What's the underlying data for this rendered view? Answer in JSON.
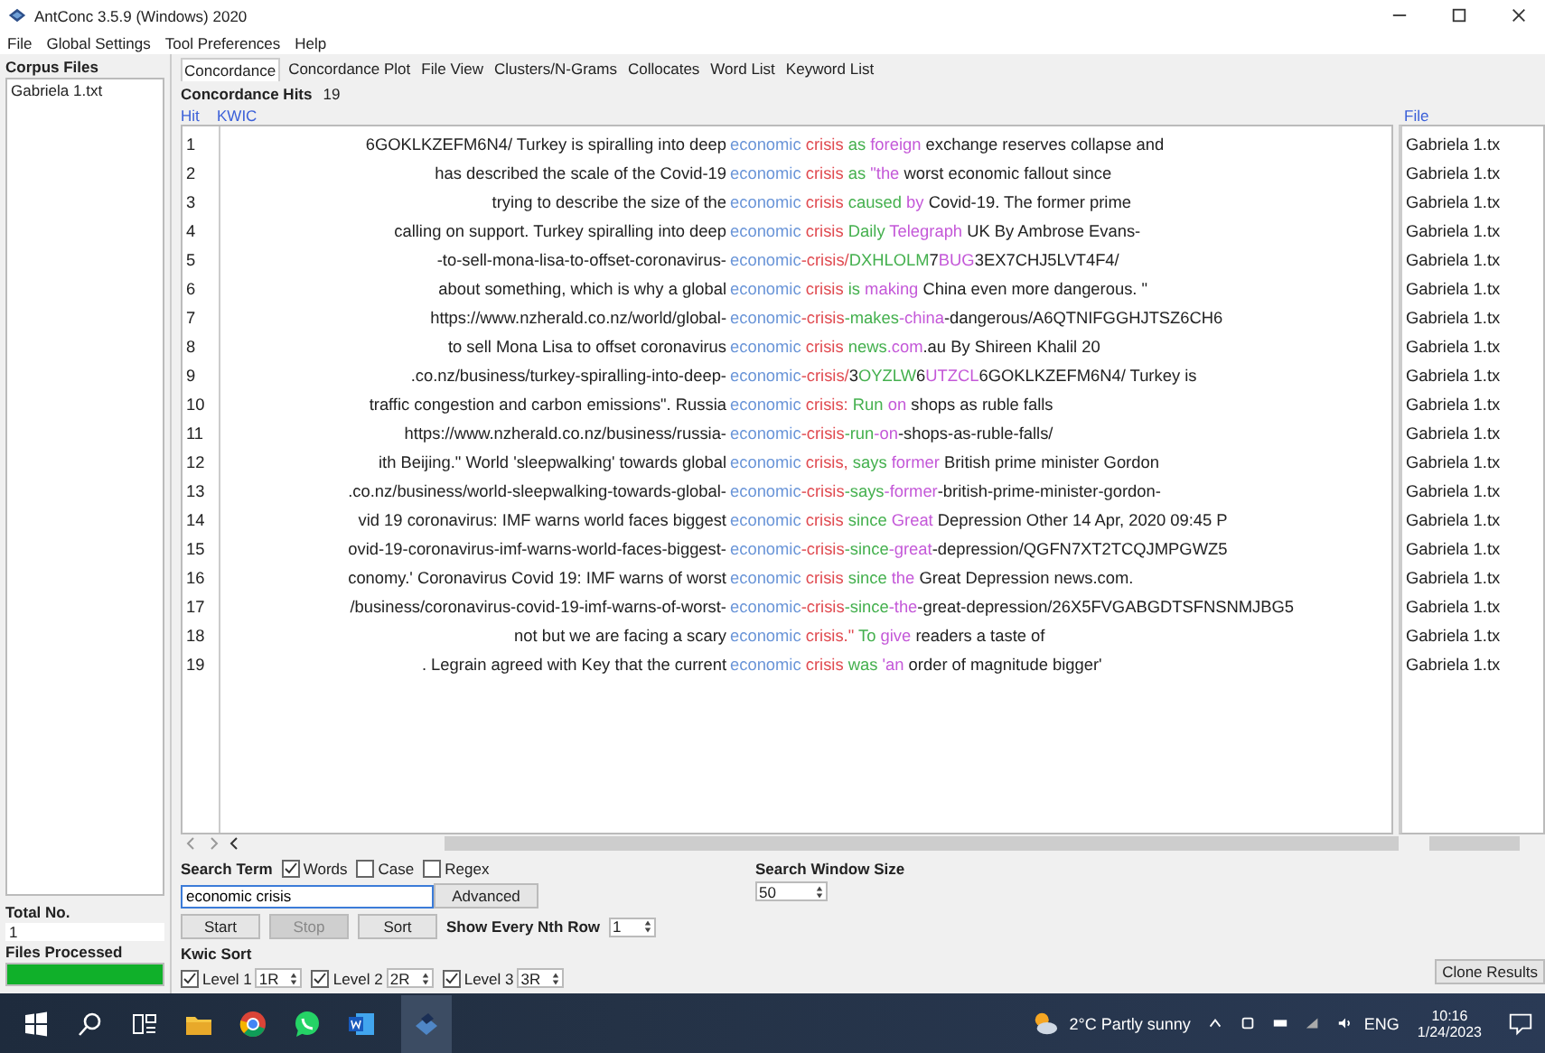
{
  "window": {
    "title": "AntConc 3.5.9 (Windows) 2020"
  },
  "menu": [
    "File",
    "Global Settings",
    "Tool Preferences",
    "Help"
  ],
  "sidebar": {
    "title": "Corpus Files",
    "files": [
      "Gabriela 1.txt"
    ],
    "total_label": "Total No.",
    "total": "1",
    "processed_label": "Files Processed",
    "progress": {
      "level": 1
    }
  },
  "tabs": [
    {
      "label": "Concordance",
      "selected": true
    },
    {
      "label": "Concordance Plot",
      "selected": false
    },
    {
      "label": "File View",
      "selected": false
    },
    {
      "label": "Clusters/N-Grams",
      "selected": false
    },
    {
      "label": "Collocates",
      "selected": false
    },
    {
      "label": "Word List",
      "selected": false
    },
    {
      "label": "Keyword List",
      "selected": false
    }
  ],
  "hits": {
    "label": "Concordance Hits",
    "count": "19"
  },
  "columns": {
    "hit": "Hit",
    "kwic": "KWIC",
    "file": "File"
  },
  "rows": [
    {
      "hit": "1",
      "left": "6GOKLKZEFM6N4/ Turkey is spiralling into deep",
      "segments": [
        {
          "text": "economic",
          "kind": "k"
        },
        {
          "text": " crisis",
          "kind": "r"
        },
        {
          "text": " as",
          "kind": "g"
        },
        {
          "text": " foreign",
          "kind": "p"
        },
        {
          "text": " exchange reserves collapse and",
          "kind": "t"
        }
      ],
      "file": "Gabriela 1.tx"
    },
    {
      "hit": "2",
      "left": "has described the scale of the Covid-19",
      "segments": [
        {
          "text": "economic",
          "kind": "k"
        },
        {
          "text": " crisis",
          "kind": "r"
        },
        {
          "text": " as",
          "kind": "g"
        },
        {
          "text": " \"the",
          "kind": "p"
        },
        {
          "text": " worst economic fallout since",
          "kind": "t"
        }
      ],
      "file": "Gabriela 1.tx"
    },
    {
      "hit": "3",
      "left": "trying to describe the size of the",
      "segments": [
        {
          "text": "economic",
          "kind": "k"
        },
        {
          "text": " crisis",
          "kind": "r"
        },
        {
          "text": " caused",
          "kind": "g"
        },
        {
          "text": " by",
          "kind": "p"
        },
        {
          "text": " Covid-19. The former prime",
          "kind": "t"
        }
      ],
      "file": "Gabriela 1.tx"
    },
    {
      "hit": "4",
      "left": "calling on support. Turkey spiralling into deep",
      "segments": [
        {
          "text": "economic",
          "kind": "k"
        },
        {
          "text": " crisis",
          "kind": "r"
        },
        {
          "text": " Daily",
          "kind": "g"
        },
        {
          "text": " Telegraph",
          "kind": "p"
        },
        {
          "text": " UK By Ambrose Evans-",
          "kind": "t"
        }
      ],
      "file": "Gabriela 1.tx"
    },
    {
      "hit": "5",
      "left": "-to-sell-mona-lisa-to-offset-coronavirus-",
      "segments": [
        {
          "text": "economic",
          "kind": "k"
        },
        {
          "text": "-crisis/",
          "kind": "r"
        },
        {
          "text": "DXHLOLM",
          "kind": "g"
        },
        {
          "text": "7",
          "kind": "t"
        },
        {
          "text": "BUG",
          "kind": "p"
        },
        {
          "text": "3EX7CHJ5LVT4F4/",
          "kind": "t"
        }
      ],
      "file": "Gabriela 1.tx"
    },
    {
      "hit": "6",
      "left": "about something, which is why a global",
      "segments": [
        {
          "text": "economic",
          "kind": "k"
        },
        {
          "text": " crisis",
          "kind": "r"
        },
        {
          "text": " is",
          "kind": "g"
        },
        {
          "text": " making",
          "kind": "p"
        },
        {
          "text": " China even more dangerous. \"",
          "kind": "t"
        }
      ],
      "file": "Gabriela 1.tx"
    },
    {
      "hit": "7",
      "left": "https://www.nzherald.co.nz/world/global-",
      "segments": [
        {
          "text": "economic",
          "kind": "k"
        },
        {
          "text": "-crisis",
          "kind": "r"
        },
        {
          "text": "-makes",
          "kind": "g"
        },
        {
          "text": "-china",
          "kind": "p"
        },
        {
          "text": "-dangerous/A6QTNIFGGHJTSZ6CH6",
          "kind": "t"
        }
      ],
      "file": "Gabriela 1.tx"
    },
    {
      "hit": "8",
      "left": "to sell Mona Lisa to offset coronavirus",
      "segments": [
        {
          "text": "economic",
          "kind": "k"
        },
        {
          "text": " crisis",
          "kind": "r"
        },
        {
          "text": " news",
          "kind": "g"
        },
        {
          "text": ".com",
          "kind": "p"
        },
        {
          "text": ".au By Shireen Khalil 20",
          "kind": "t"
        }
      ],
      "file": "Gabriela 1.tx"
    },
    {
      "hit": "9",
      "left": ".co.nz/business/turkey-spiralling-into-deep-",
      "segments": [
        {
          "text": "economic",
          "kind": "k"
        },
        {
          "text": "-crisis/",
          "kind": "r"
        },
        {
          "text": "3",
          "kind": "t"
        },
        {
          "text": "OYZLW",
          "kind": "g"
        },
        {
          "text": "6",
          "kind": "t"
        },
        {
          "text": "UTZCL",
          "kind": "p"
        },
        {
          "text": "6GOKLKZEFM6N4/ Turkey is",
          "kind": "t"
        }
      ],
      "file": "Gabriela 1.tx"
    },
    {
      "hit": "10",
      "left": "traffic congestion and carbon emissions\". Russia",
      "segments": [
        {
          "text": "economic",
          "kind": "k"
        },
        {
          "text": " crisis:",
          "kind": "r"
        },
        {
          "text": " Run",
          "kind": "g"
        },
        {
          "text": " on",
          "kind": "p"
        },
        {
          "text": " shops as ruble falls",
          "kind": "t"
        }
      ],
      "file": "Gabriela 1.tx"
    },
    {
      "hit": "11",
      "left": "https://www.nzherald.co.nz/business/russia-",
      "segments": [
        {
          "text": "economic",
          "kind": "k"
        },
        {
          "text": "-crisis",
          "kind": "r"
        },
        {
          "text": "-run",
          "kind": "g"
        },
        {
          "text": "-on",
          "kind": "p"
        },
        {
          "text": "-shops-as-ruble-falls/",
          "kind": "t"
        }
      ],
      "file": "Gabriela 1.tx"
    },
    {
      "hit": "12",
      "left": "ith Beijing.\" World 'sleepwalking' towards global",
      "segments": [
        {
          "text": "economic",
          "kind": "k"
        },
        {
          "text": " crisis,",
          "kind": "r"
        },
        {
          "text": " says",
          "kind": "g"
        },
        {
          "text": " former",
          "kind": "p"
        },
        {
          "text": " British prime minister Gordon",
          "kind": "t"
        }
      ],
      "file": "Gabriela 1.tx"
    },
    {
      "hit": "13",
      "left": ".co.nz/business/world-sleepwalking-towards-global-",
      "segments": [
        {
          "text": "economic",
          "kind": "k"
        },
        {
          "text": "-crisis",
          "kind": "r"
        },
        {
          "text": "-says",
          "kind": "g"
        },
        {
          "text": "-former",
          "kind": "p"
        },
        {
          "text": "-british-prime-minister-gordon-",
          "kind": "t"
        }
      ],
      "file": "Gabriela 1.tx"
    },
    {
      "hit": "14",
      "left": "vid 19 coronavirus: IMF warns world faces biggest",
      "segments": [
        {
          "text": "economic",
          "kind": "k"
        },
        {
          "text": " crisis",
          "kind": "r"
        },
        {
          "text": " since",
          "kind": "g"
        },
        {
          "text": " Great",
          "kind": "p"
        },
        {
          "text": " Depression Other 14 Apr, 2020 09:45 P",
          "kind": "t"
        }
      ],
      "file": "Gabriela 1.tx"
    },
    {
      "hit": "15",
      "left": "ovid-19-coronavirus-imf-warns-world-faces-biggest-",
      "segments": [
        {
          "text": "economic",
          "kind": "k"
        },
        {
          "text": "-crisis",
          "kind": "r"
        },
        {
          "text": "-since",
          "kind": "g"
        },
        {
          "text": "-great",
          "kind": "p"
        },
        {
          "text": "-depression/QGFN7XT2TCQJMPGWZ5",
          "kind": "t"
        }
      ],
      "file": "Gabriela 1.tx"
    },
    {
      "hit": "16",
      "left": "conomy.' Coronavirus Covid 19: IMF warns of worst",
      "segments": [
        {
          "text": "economic",
          "kind": "k"
        },
        {
          "text": " crisis",
          "kind": "r"
        },
        {
          "text": " since",
          "kind": "g"
        },
        {
          "text": " the",
          "kind": "p"
        },
        {
          "text": " Great Depression news.com.",
          "kind": "t"
        }
      ],
      "file": "Gabriela 1.tx"
    },
    {
      "hit": "17",
      "left": "/business/coronavirus-covid-19-imf-warns-of-worst-",
      "segments": [
        {
          "text": "economic",
          "kind": "k"
        },
        {
          "text": "-crisis",
          "kind": "r"
        },
        {
          "text": "-since",
          "kind": "g"
        },
        {
          "text": "-the",
          "kind": "p"
        },
        {
          "text": "-great-depression/26X5FVGABGDTSFNSNMJBG5",
          "kind": "t"
        }
      ],
      "file": "Gabriela 1.tx"
    },
    {
      "hit": "18",
      "left": "not but we are facing a scary",
      "segments": [
        {
          "text": "economic",
          "kind": "k"
        },
        {
          "text": " crisis.\"",
          "kind": "r"
        },
        {
          "text": " To",
          "kind": "g"
        },
        {
          "text": " give",
          "kind": "p"
        },
        {
          "text": " readers a taste of",
          "kind": "t"
        }
      ],
      "file": "Gabriela 1.tx"
    },
    {
      "hit": "19",
      "left": ". Legrain agreed with Key that the current",
      "segments": [
        {
          "text": "economic",
          "kind": "k"
        },
        {
          "text": " crisis",
          "kind": "r"
        },
        {
          "text": " was",
          "kind": "g"
        },
        {
          "text": " 'an",
          "kind": "p"
        },
        {
          "text": " order of magnitude bigger'",
          "kind": "t"
        }
      ],
      "file": "Gabriela 1.tx"
    }
  ],
  "search": {
    "label": "Search Term",
    "options": [
      {
        "label": "Words",
        "checked": true
      },
      {
        "label": "Case",
        "checked": false
      },
      {
        "label": "Regex",
        "checked": false
      }
    ],
    "value": "economic crisis",
    "advanced": "Advanced",
    "window_size_label": "Search Window Size",
    "window_size": "50"
  },
  "buttons": [
    {
      "label": "Start",
      "disabled": false
    },
    {
      "label": "Stop",
      "disabled": true
    },
    {
      "label": "Sort",
      "disabled": false
    }
  ],
  "nth": {
    "label": "Show Every Nth Row",
    "value": "1"
  },
  "kwic_sort": {
    "label": "Kwic Sort",
    "levels": [
      {
        "label": "Level 1",
        "checked": true,
        "value": "1R"
      },
      {
        "label": "Level 2",
        "checked": true,
        "value": "2R"
      },
      {
        "label": "Level 3",
        "checked": true,
        "value": "3R"
      }
    ]
  },
  "clone": "Clone Results",
  "taskbar": {
    "weather": "2°C Partly sunny",
    "lang": "ENG",
    "time": "10:16",
    "date": "1/24/2023"
  }
}
